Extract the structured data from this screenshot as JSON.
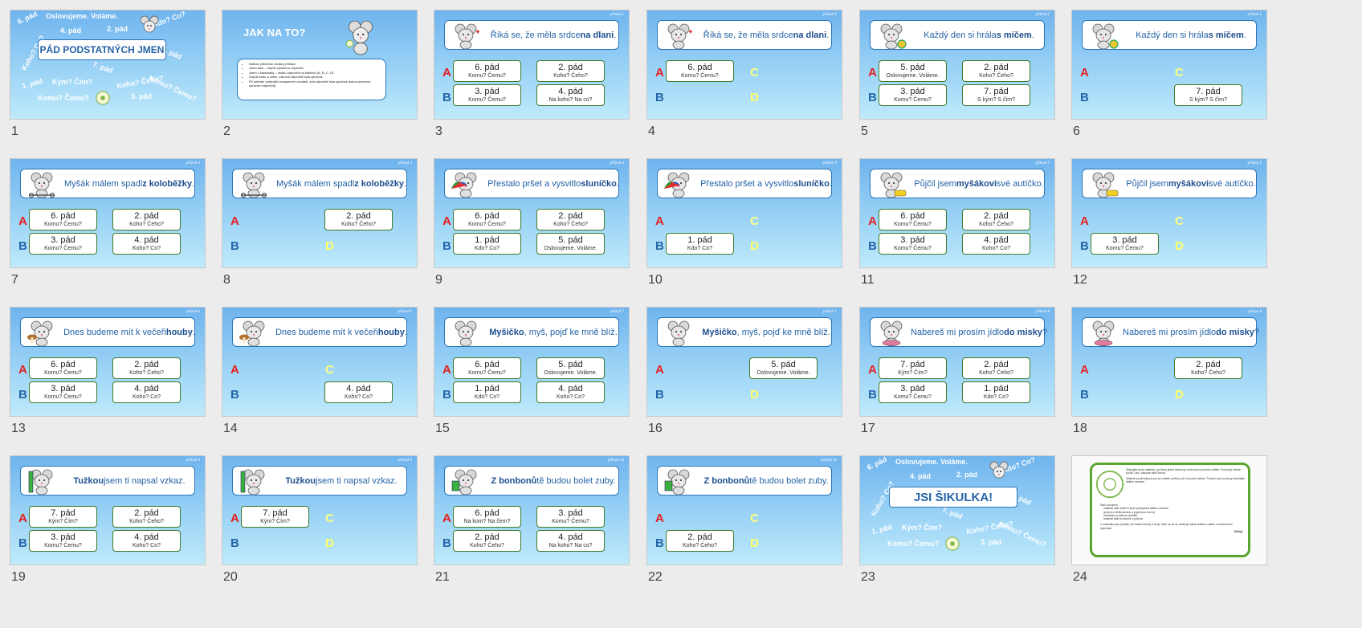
{
  "slide_numbers": [
    "1",
    "2",
    "3",
    "4",
    "5",
    "6",
    "7",
    "8",
    "9",
    "10",
    "11",
    "12",
    "13",
    "14",
    "15",
    "16",
    "17",
    "18",
    "19",
    "20",
    "21",
    "22",
    "23",
    "24"
  ],
  "title_slide": {
    "title": "PÁD PODSTATNÝCH JMEN",
    "words": [
      "6. pád",
      "Oslovujeme. Voláme.",
      "Kdo? Co?",
      "4. pád",
      "2. pád",
      "5. pád",
      "Koho? Co?",
      "7. pád",
      "Kým? Čím?",
      "1. pád",
      "Koho? Čeho?",
      "Komu? Čemu?",
      "Komu? Čemu?",
      "3. pád"
    ]
  },
  "instructions_slide": {
    "title": "JAK NA TO?",
    "bullets": [
      "Nahlas přečteme zadaný příklad.",
      "Jsem sám – napíši vybranou odpověď.",
      "Jsem s kamarády – ukážu odpověď na kartičce (A, B, C, D).",
      "Dopíši kartu a vidím, zda má odpověď byla správná.",
      "Při sebrání výsledků nezapomeň oznámit, zda odpověď byla správná (barva písmena správné odpovědi)."
    ]
  },
  "letters": {
    "a": "A",
    "b": "B",
    "c": "C",
    "d": "D"
  },
  "quiz_slides": [
    {
      "n": 0,
      "label": "příklad 1",
      "q": [
        "Říká se, že měla srdce ",
        "na dlani",
        "."
      ],
      "ans": {
        "a": [
          "6. pád",
          "Komu? Čemu?"
        ],
        "b": [
          "3. pád",
          "Komu? Čemu?"
        ],
        "c": [
          "2. pád",
          "Koho? Čeho?"
        ],
        "d": [
          "4. pád",
          "Na koho? Na co?"
        ]
      }
    },
    {
      "n": 1,
      "label": "příklad 1",
      "q": [
        "Říká se, že měla srdce ",
        "na dlani",
        "."
      ],
      "ans": {
        "a": [
          "6. pád",
          "Komu? Čemu?"
        ]
      }
    },
    {
      "n": 2,
      "label": "příklad 2",
      "q": [
        "Každý den si hrála ",
        "s míčem",
        "."
      ],
      "ans": {
        "a": [
          "5. pád",
          "Oslovujeme. Voláme."
        ],
        "b": [
          "3. pád",
          "Komu? Čemu?"
        ],
        "c": [
          "2. pád",
          "Koho? Čeho?"
        ],
        "d": [
          "7. pád",
          "S kým? S čím?"
        ]
      }
    },
    {
      "n": 3,
      "label": "příklad 2",
      "q": [
        "Každý den si hrála ",
        "s míčem",
        "."
      ],
      "ans": {
        "d": [
          "7. pád",
          "S kým? S čím?"
        ]
      }
    },
    {
      "n": 4,
      "label": "příklad 3",
      "q": [
        "Myšák málem spadl ",
        "z koloběžky",
        "."
      ],
      "ans": {
        "a": [
          "6. pád",
          "Komu? Čemu?"
        ],
        "b": [
          "3. pád",
          "Komu? Čemu?"
        ],
        "c": [
          "2. pád",
          "Koho? Čeho?"
        ],
        "d": [
          "4. pád",
          "Koho? Co?"
        ]
      }
    },
    {
      "n": 5,
      "label": "příklad 3",
      "q": [
        "Myšák málem spadl ",
        "z koloběžky",
        "."
      ],
      "ans": {
        "c": [
          "2. pád",
          "Koho? Čeho?"
        ]
      }
    },
    {
      "n": 6,
      "label": "příklad 4",
      "q": [
        "Přestalo pršet a vysvitlo ",
        "sluníčko",
        "."
      ],
      "ans": {
        "a": [
          "6. pád",
          "Komu? Čemu?"
        ],
        "b": [
          "1. pád",
          "Kdo? Co?"
        ],
        "c": [
          "2. pád",
          "Koho? Čeho?"
        ],
        "d": [
          "5. pád",
          "Oslovujeme. Voláme."
        ]
      }
    },
    {
      "n": 7,
      "label": "příklad 4",
      "q": [
        "Přestalo pršet a vysvitlo ",
        "sluníčko",
        "."
      ],
      "ans": {
        "b": [
          "1. pád",
          "Kdo? Co?"
        ]
      }
    },
    {
      "n": 8,
      "label": "příklad 5",
      "q": [
        "Půjčil jsem ",
        "myšákovi",
        " své autíčko."
      ],
      "ans": {
        "a": [
          "6. pád",
          "Komu? Čemu?"
        ],
        "b": [
          "3. pád",
          "Komu? Čemu?"
        ],
        "c": [
          "2. pád",
          "Koho? Čeho?"
        ],
        "d": [
          "4. pád",
          "Koho? Co?"
        ]
      }
    },
    {
      "n": 9,
      "label": "příklad 5",
      "q": [
        "Půjčil jsem ",
        "myšákovi",
        " své autíčko."
      ],
      "ans": {
        "b": [
          "3. pád",
          "Komu? Čemu?"
        ]
      }
    },
    {
      "n": 10,
      "label": "příklad 6",
      "q": [
        "Dnes budeme mít k večeři ",
        "houby",
        "."
      ],
      "ans": {
        "a": [
          "6. pád",
          "Komu? Čemu?"
        ],
        "b": [
          "3. pád",
          "Komu? Čemu?"
        ],
        "c": [
          "2. pád",
          "Koho? Čeho?"
        ],
        "d": [
          "4. pád",
          "Koho? Co?"
        ]
      }
    },
    {
      "n": 11,
      "label": "příklad 6",
      "q": [
        "Dnes budeme mít k večeři ",
        "houby",
        "."
      ],
      "ans": {
        "d": [
          "4. pád",
          "Koho? Co?"
        ]
      }
    },
    {
      "n": 12,
      "label": "příklad 7",
      "q": [
        "",
        "Myšičko",
        ", myš, pojď ke mně blíž."
      ],
      "ans": {
        "a": [
          "6. pád",
          "Komu? Čemu?"
        ],
        "b": [
          "1. pád",
          "Kdo? Co?"
        ],
        "c": [
          "5. pád",
          "Oslovujeme. Voláme."
        ],
        "d": [
          "4. pád",
          "Koho? Co?"
        ]
      }
    },
    {
      "n": 13,
      "label": "příklad 7",
      "q": [
        "",
        "Myšičko",
        ", myš, pojď ke mně blíž."
      ],
      "ans": {
        "c": [
          "5. pád",
          "Oslovujeme. Voláme."
        ]
      }
    },
    {
      "n": 14,
      "label": "příklad 8",
      "q": [
        "Nabereš mi prosím jídlo ",
        "do misky",
        "?"
      ],
      "ans": {
        "a": [
          "7. pád",
          "Kým? Čím?"
        ],
        "b": [
          "3. pád",
          "Komu? Čemu?"
        ],
        "c": [
          "2. pád",
          "Koho? Čeho?"
        ],
        "d": [
          "1. pád",
          "Kdo? Co?"
        ]
      }
    },
    {
      "n": 15,
      "label": "příklad 8",
      "q": [
        "Nabereš mi prosím jídlo ",
        "do misky",
        "?"
      ],
      "ans": {
        "c": [
          "2. pád",
          "Koho? Čeho?"
        ]
      }
    },
    {
      "n": 16,
      "label": "příklad 9",
      "q": [
        "",
        "Tužkou",
        " jsem ti napsal vzkaz."
      ],
      "ans": {
        "a": [
          "7. pád",
          "Kým? Čím?"
        ],
        "b": [
          "3. pád",
          "Komu? Čemu?"
        ],
        "c": [
          "2. pád",
          "Koho? Čeho?"
        ],
        "d": [
          "4. pád",
          "Koho? Co?"
        ]
      }
    },
    {
      "n": 17,
      "label": "příklad 9",
      "q": [
        "",
        "Tužkou",
        " jsem ti napsal vzkaz."
      ],
      "ans": {
        "a": [
          "7. pád",
          "Kým? Čím?"
        ]
      }
    },
    {
      "n": 18,
      "label": "příklad 10",
      "q": [
        "",
        "Z bonbonů",
        " tě budou bolet zuby."
      ],
      "ans": {
        "a": [
          "6. pád",
          "Na kom? Na čem?"
        ],
        "b": [
          "2. pád",
          "Koho? Čeho?"
        ],
        "c": [
          "3. pád",
          "Komu? Čemu?"
        ],
        "d": [
          "4. pád",
          "Na koho? Na co?"
        ]
      }
    },
    {
      "n": 19,
      "label": "příklad 10",
      "q": [
        "",
        "Z bonbonů",
        " tě budou bolet zuby."
      ],
      "ans": {
        "b": [
          "2. pád",
          "Koho? Čeho?"
        ]
      }
    }
  ],
  "end_slide": {
    "title": "JSI ŠIKULKA!"
  },
  "license_slide": {
    "paragraphs": [
      "Stáhujete tento materiál, pro který jedna licence je určena pro jednoho učitele. Pokud jej chcete použít i jiný, zakupte další licenci.",
      "Materiál používejte pouze pro vlastní potřebu, při své práci učitele. Prosíme tyto soubory nesdílejte dalším osobám."
    ],
    "list_title": "Není povoleno:",
    "list": [
      "materiál dále sdílet či jinak poskytovat dalším osobám",
      "(platí pro elektronickou a papírovou formu)",
      "nahrávat na sdílená úložiště",
      "materiál dále komerčně využívat"
    ],
    "footer": "V materiálu jsou použity mé vlastní kresby a texty. Také na ně se vztahuje zákaz dalšího sdílení a komerčního využívání.",
    "thanks": "Děkuji."
  },
  "colors": {
    "A": "#e62020",
    "B": "#2466aa",
    "C": "#ffff80",
    "D": "#ffff66",
    "accent": "#2463a6"
  },
  "icons": [
    "mouse-with-heart-icon",
    "mouse-with-ball-icon",
    "mouse-on-scooter-icon",
    "umbrella-icon",
    "mouse-car-icon",
    "mushroom-icon",
    "mouse-icon",
    "bowl-icon",
    "pencil-icon",
    "candy-icon",
    "logo-icon"
  ]
}
